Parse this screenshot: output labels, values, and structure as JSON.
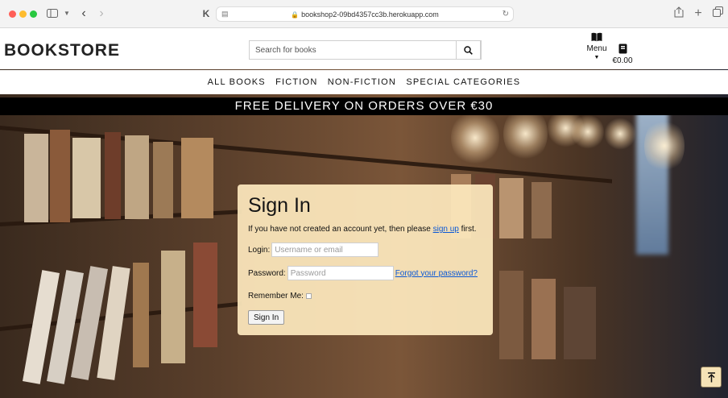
{
  "browser": {
    "url": "bookshop2-09bd4357cc3b.herokuapp.com",
    "icons": [
      "sidebar-icon",
      "chevron-down-icon",
      "back-icon",
      "forward-icon",
      "extension-icon",
      "lock-icon",
      "reload-icon",
      "share-icon",
      "new-tab-icon",
      "tab-overview-icon"
    ]
  },
  "header": {
    "logo": "BOOKSTORE",
    "search_placeholder": "Search for books",
    "menu_label": "Menu",
    "cart_total": "€0.00"
  },
  "nav": {
    "items": [
      {
        "label": "ALL BOOKS"
      },
      {
        "label": "FICTION"
      },
      {
        "label": "NON-FICTION"
      },
      {
        "label": "SPECIAL CATEGORIES"
      }
    ]
  },
  "promo": "FREE DELIVERY ON ORDERS OVER €30",
  "signin": {
    "title": "Sign In",
    "intro_before": "If you have not created an account yet, then please ",
    "signup_link": "sign up",
    "intro_after": " first.",
    "login_label": "Login:",
    "login_placeholder": "Username or email",
    "password_label": "Password:",
    "password_placeholder": "Password",
    "forgot_link": "Forgot your password?",
    "remember_label": "Remember Me:",
    "submit_label": "Sign In"
  },
  "colors": {
    "card_bg": "#fde8bd",
    "link": "#0b58d6",
    "promo_bg": "#000000"
  }
}
